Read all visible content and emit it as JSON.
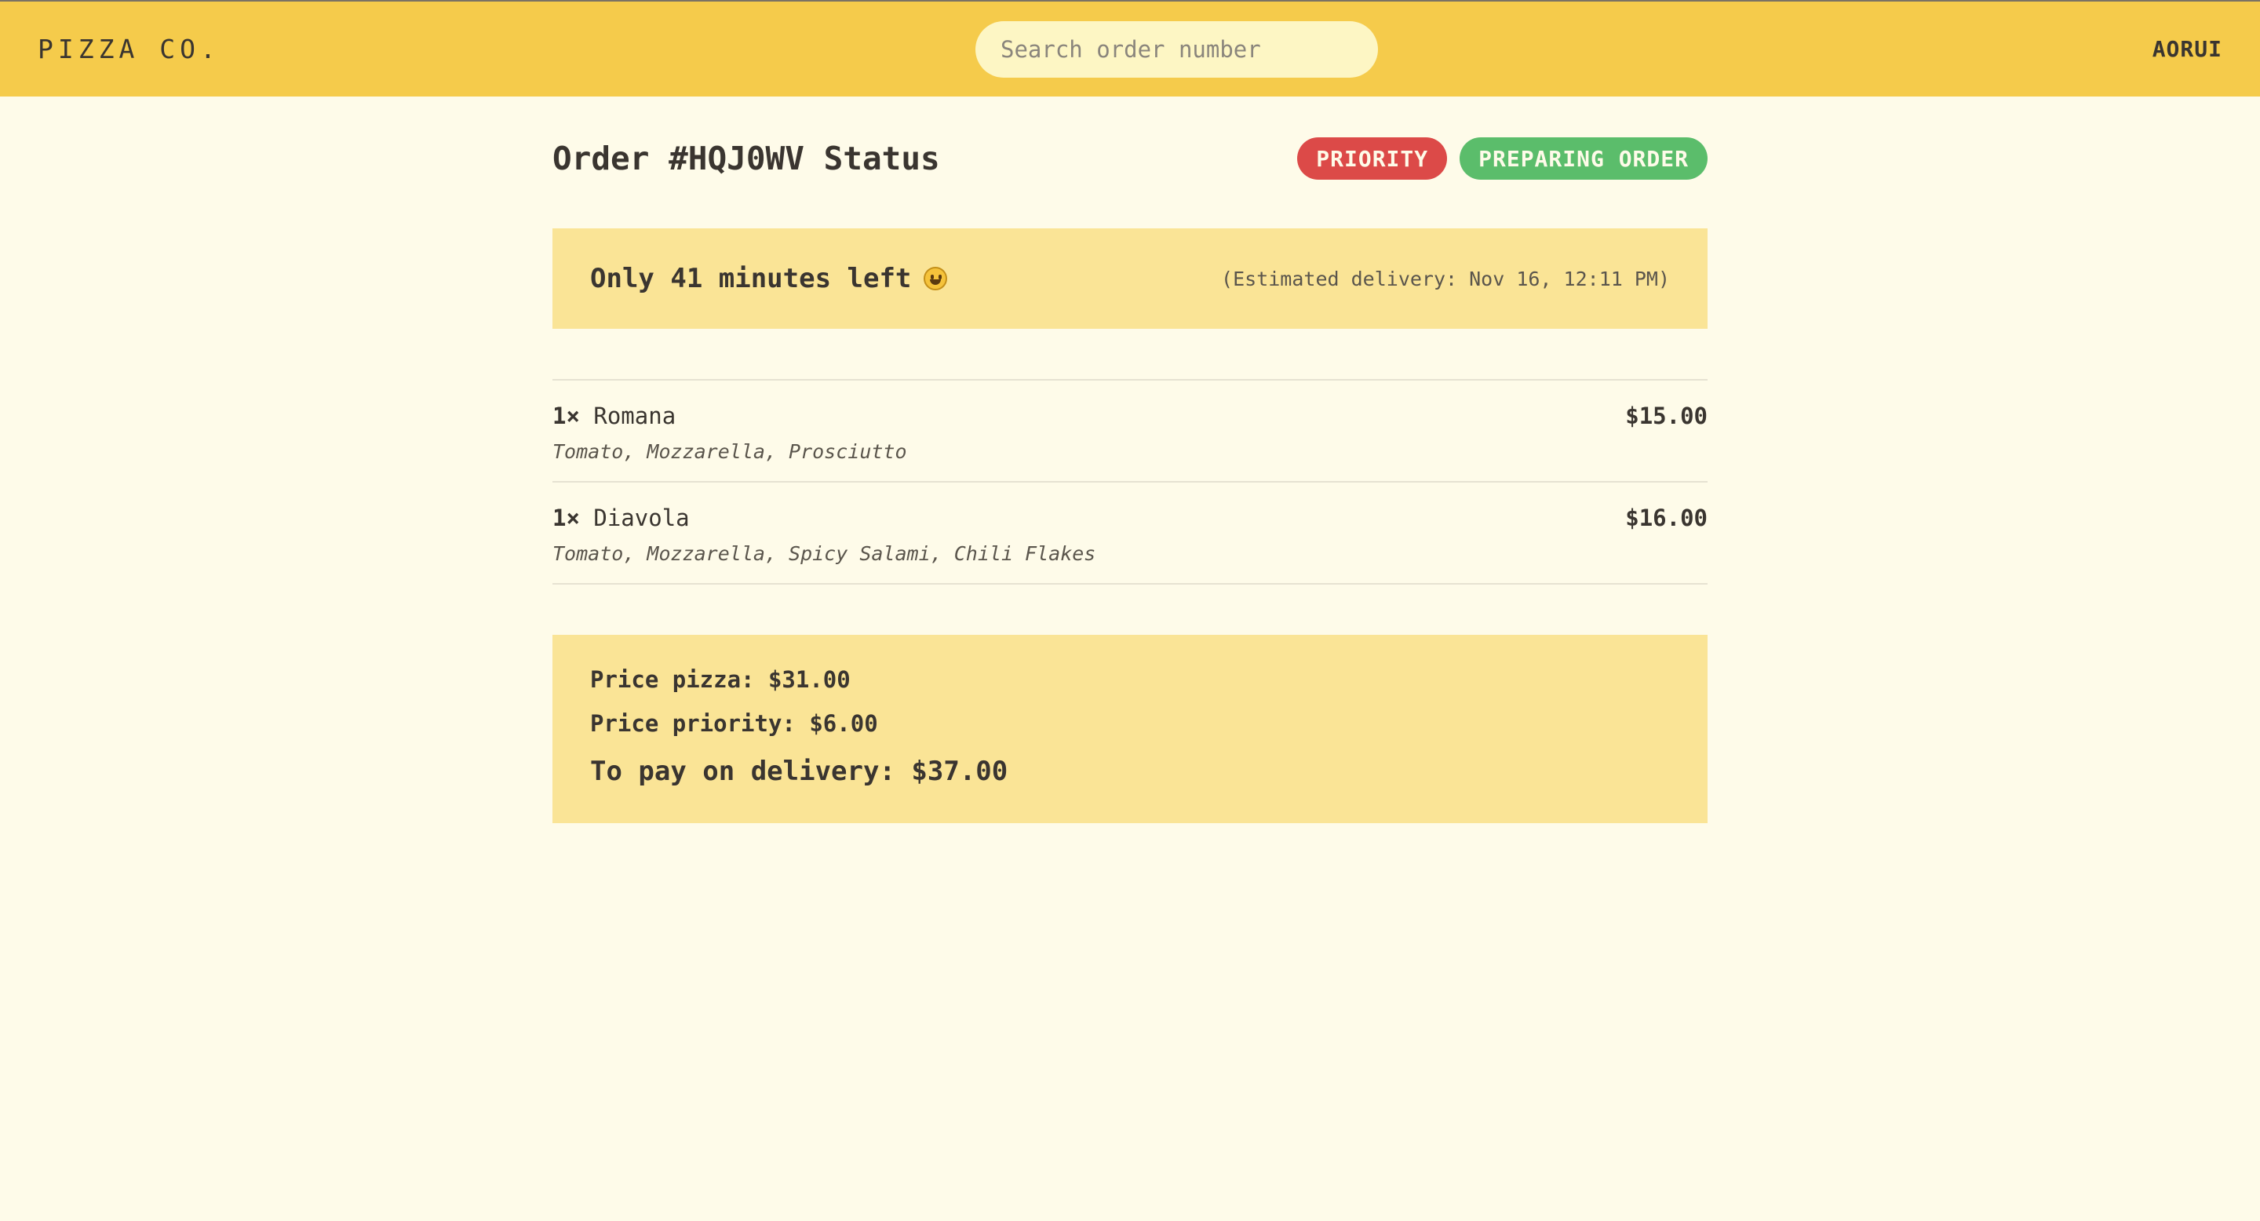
{
  "header": {
    "brand": "PIZZA CO.",
    "search_placeholder": "Search order number",
    "search_value": "",
    "user": "AORUI"
  },
  "order": {
    "title": "Order #HQJ0WV Status",
    "badges": [
      {
        "label": "PRIORITY",
        "color": "#dc4a48"
      },
      {
        "label": "PREPARING ORDER",
        "color": "#5bbd6b"
      }
    ],
    "countdown": "Only 41 minutes left",
    "countdown_icon": "grinning-face-icon",
    "estimated_delivery": "(Estimated delivery: Nov 16, 12:11 PM)",
    "items": [
      {
        "quantity": "1×",
        "name": "Romana",
        "ingredients": "Tomato, Mozzarella, Prosciutto",
        "price": "$15.00"
      },
      {
        "quantity": "1×",
        "name": "Diavola",
        "ingredients": "Tomato, Mozzarella, Spicy Salami, Chili Flakes",
        "price": "$16.00"
      }
    ],
    "summary": {
      "price_pizza": "Price pizza: $31.00",
      "price_priority": "Price priority: $6.00",
      "total": "To pay on delivery: $37.00"
    }
  },
  "colors": {
    "header_bg": "#f5cb4b",
    "page_bg": "#fefbe9",
    "panel_bg": "#fae496",
    "priority": "#dc4a48",
    "status": "#5bbd6b"
  }
}
